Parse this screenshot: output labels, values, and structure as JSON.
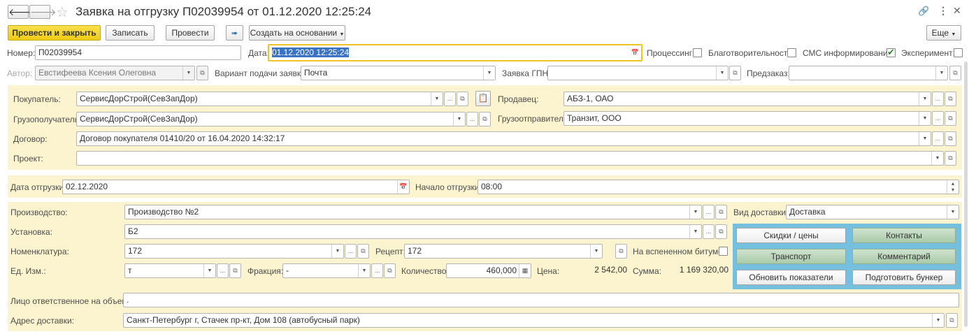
{
  "title": "Заявка на отгрузку П02039954 от 01.12.2020 12:25:24",
  "toolbar": {
    "post_close": "Провести и закрыть",
    "save": "Записать",
    "post": "Провести",
    "create_based": "Создать на основании",
    "more": "Еще"
  },
  "header": {
    "number_label": "Номер:",
    "number": "П02039954",
    "date_label": "Дата:",
    "date": "01.12.2020 12:25:24",
    "processing_label": "Процессинг:",
    "charity_label": "Благотворительность:",
    "sms_label": "СМС информирование:",
    "experiment_label": "Эксперимент:",
    "author_label": "Автор:",
    "author": "Евстифеева Ксения Олеговна",
    "variant_label": "Вариант подачи заявки:",
    "variant": "Почта",
    "gpn_label": "Заявка ГПН:",
    "gpn": "",
    "preorder_label": "Предзаказ:",
    "preorder": ""
  },
  "parties": {
    "buyer_label": "Покупатель:",
    "buyer": "СервисДорСтрой(СевЗапДор)",
    "consignee_label": "Грузополучатель:",
    "consignee": "СервисДорСтрой(СевЗапДор)",
    "contract_label": "Договор:",
    "contract": "Договор покупателя 01410/20 от 16.04.2020 14:32:17",
    "project_label": "Проект:",
    "project": "",
    "seller_label": "Продавец:",
    "seller": "АБЗ-1, ОАО",
    "shipper_label": "Грузоотправитель:",
    "shipper": "Транзит, ООО"
  },
  "shipment": {
    "date_label": "Дата отгрузки:",
    "date": "02.12.2020",
    "start_label": "Начало отгрузки:",
    "start": "08:00"
  },
  "production": {
    "production_label": "Производство:",
    "production": "Производство №2",
    "plant_label": "Установка:",
    "plant": "Б2",
    "nomenclature_label": "Номенклатура:",
    "nomenclature": "172",
    "recipe_label": "Рецепт:",
    "recipe": "172",
    "foamed_label": "На вспененном битуме:",
    "unit_label": "Ед. Изм.:",
    "unit": "т",
    "fraction_label": "Фракция:",
    "fraction": "-",
    "qty_label": "Количество:",
    "qty": "460,000",
    "price_label": "Цена:",
    "price": "2 542,00",
    "sum_label": "Сумма:",
    "sum": "1 169 320,00",
    "delivery_type_label": "Вид доставки:",
    "delivery_type": "Доставка",
    "responsible_label": "Лицо ответственное на объекте:",
    "responsible": ".",
    "address_label": "Адрес доставки:",
    "address": "Санкт-Петербург г, Стачек пр-кт, Дом 108 (автобусный парк)"
  },
  "actions": {
    "discounts": "Скидки / цены",
    "contacts": "Контакты",
    "transport": "Транспорт",
    "comment": "Комментарий",
    "refresh": "Обновить показатели",
    "bunker": "Подготовить бункер"
  },
  "icons": [
    "back-icon",
    "forward-icon",
    "star-icon",
    "link-icon",
    "more-icon",
    "close-icon",
    "calendar-icon",
    "dropdown-icon",
    "open-icon",
    "copy-icon"
  ]
}
